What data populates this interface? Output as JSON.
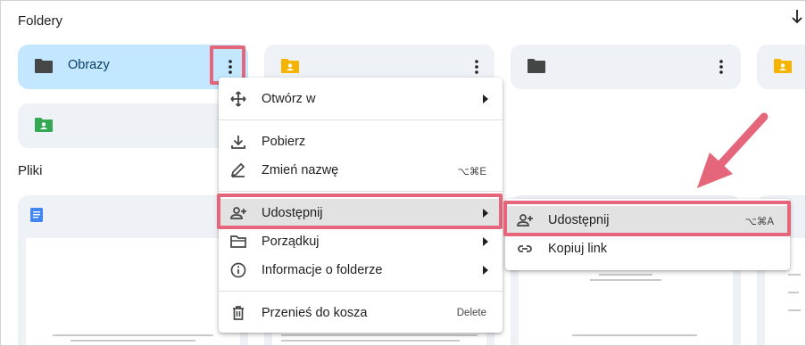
{
  "sections": {
    "folders_title": "Foldery",
    "files_title": "Pliki"
  },
  "folders": [
    {
      "name": "Obrazy",
      "icon": "folder-icon",
      "color": "#444746",
      "selected": true
    },
    {
      "name": "",
      "icon": "shared-folder-icon",
      "color": "#f4b400"
    },
    {
      "name": "",
      "icon": "folder-icon",
      "color": "#444746"
    },
    {
      "name": "",
      "icon": "shared-folder-icon",
      "color": "#f4b400"
    },
    {
      "name": "",
      "icon": "shared-folder-icon",
      "color": "#34a853"
    }
  ],
  "context_menu": {
    "items": [
      {
        "label": "Otwórz w",
        "icon": "move-icon",
        "submenu": true
      },
      {
        "label": "Pobierz",
        "icon": "download-icon"
      },
      {
        "label": "Zmień nazwę",
        "icon": "rename-icon",
        "shortcut": "⌥⌘E"
      },
      {
        "label": "Udostępnij",
        "icon": "share-person-icon",
        "submenu": true
      },
      {
        "label": "Porządkuj",
        "icon": "organize-folder-icon",
        "submenu": true
      },
      {
        "label": "Informacje o folderze",
        "icon": "info-icon",
        "submenu": true
      },
      {
        "label": "Przenieś do kosza",
        "icon": "trash-icon",
        "shortcut": "Delete"
      }
    ]
  },
  "share_submenu": {
    "items": [
      {
        "label": "Udostępnij",
        "icon": "share-person-icon",
        "shortcut": "⌥⌘A"
      },
      {
        "label": "Kopiuj link",
        "icon": "link-icon"
      }
    ]
  },
  "colors": {
    "highlight": "#e5667b",
    "selected_folder": "#c2e7ff",
    "card_bg": "#eef1f6",
    "doc_blue": "#4285f4"
  }
}
